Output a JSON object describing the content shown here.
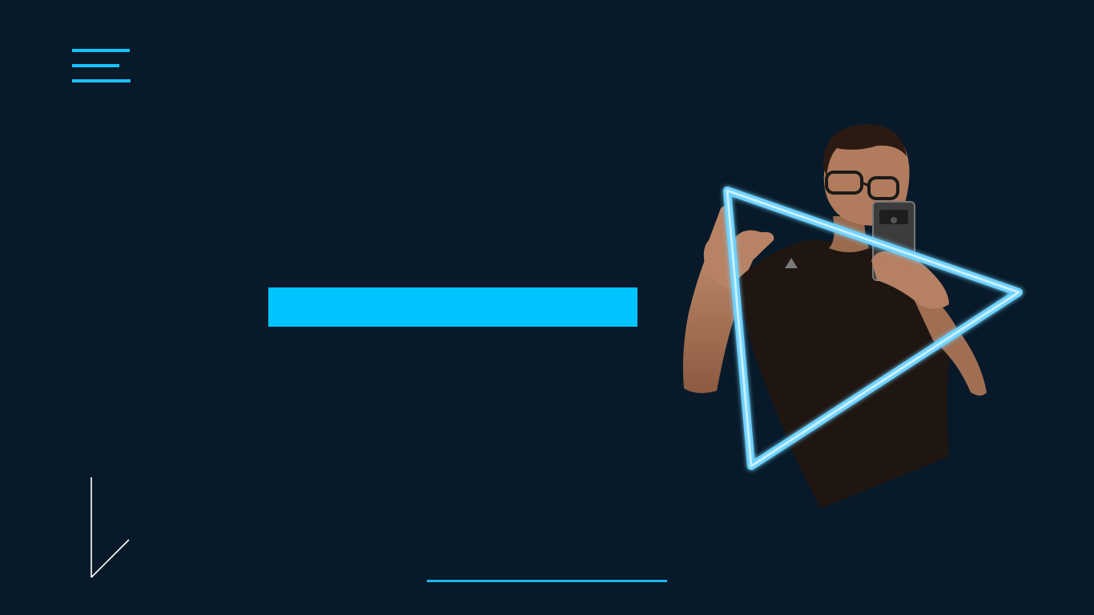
{
  "nav": {
    "menu_icon": "hamburger-menu-icon"
  },
  "hero": {
    "bar_icon": "cyan-bar"
  },
  "portrait": {
    "description_icon": "person-selfie-illustration",
    "frame_icon": "play-triangle-icon"
  },
  "decorations": {
    "corner_icon": "check-stroke-icon",
    "line_icon": "divider-line"
  },
  "colors": {
    "background": "#081a29",
    "accent": "#18c2ff",
    "bar": "#00c4ff",
    "glow": "#6fd3ff"
  }
}
